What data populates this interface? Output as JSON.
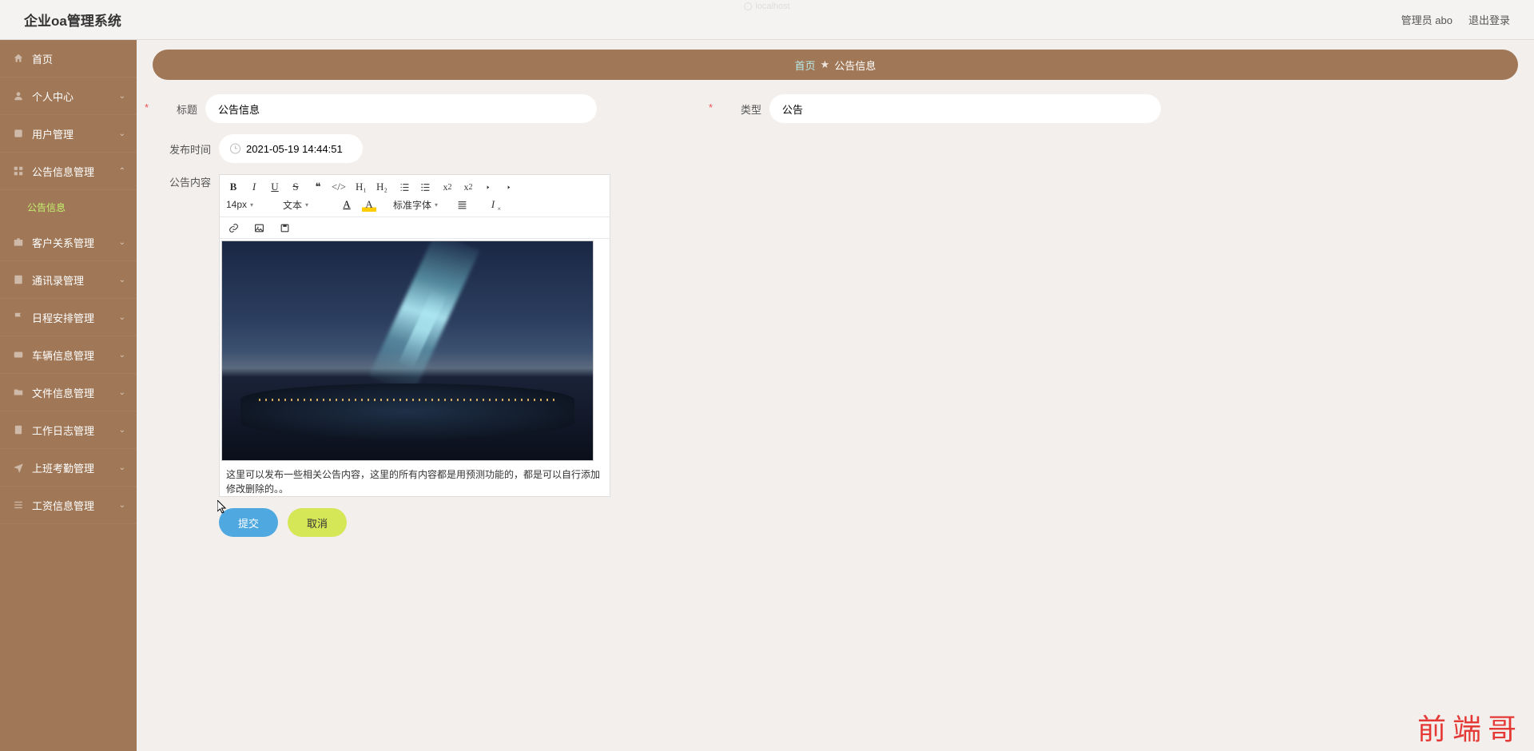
{
  "header": {
    "title": "企业oa管理系统",
    "ghost_label": "localhost",
    "user_label": "管理员 abo",
    "logout_label": "退出登录"
  },
  "sidebar": {
    "items": [
      {
        "label": "首页"
      },
      {
        "label": "个人中心"
      },
      {
        "label": "用户管理"
      },
      {
        "label": "公告信息管理",
        "expanded": true
      },
      {
        "label": "客户关系管理"
      },
      {
        "label": "通讯录管理"
      },
      {
        "label": "日程安排管理"
      },
      {
        "label": "车辆信息管理"
      },
      {
        "label": "文件信息管理"
      },
      {
        "label": "工作日志管理"
      },
      {
        "label": "上班考勤管理"
      },
      {
        "label": "工资信息管理"
      }
    ],
    "sub_item": "公告信息"
  },
  "breadcrumb": {
    "home": "首页",
    "sep": "★",
    "current": "公告信息"
  },
  "form": {
    "title_label": "标题",
    "title_value": "公告信息",
    "type_label": "类型",
    "type_value": "公告",
    "publish_label": "发布时间",
    "publish_value": "2021-05-19 14:44:51",
    "content_label": "公告内容"
  },
  "editor": {
    "font_size": "14px",
    "font_style": "文本",
    "font_family": "标准字体",
    "h1": "H₁",
    "h2": "H₂",
    "content_text": "这里可以发布一些相关公告内容，这里的所有内容都是用预测功能的，都是可以自行添加修改删除的。。"
  },
  "buttons": {
    "submit": "提交",
    "cancel": "取消"
  },
  "watermark": "前端哥"
}
